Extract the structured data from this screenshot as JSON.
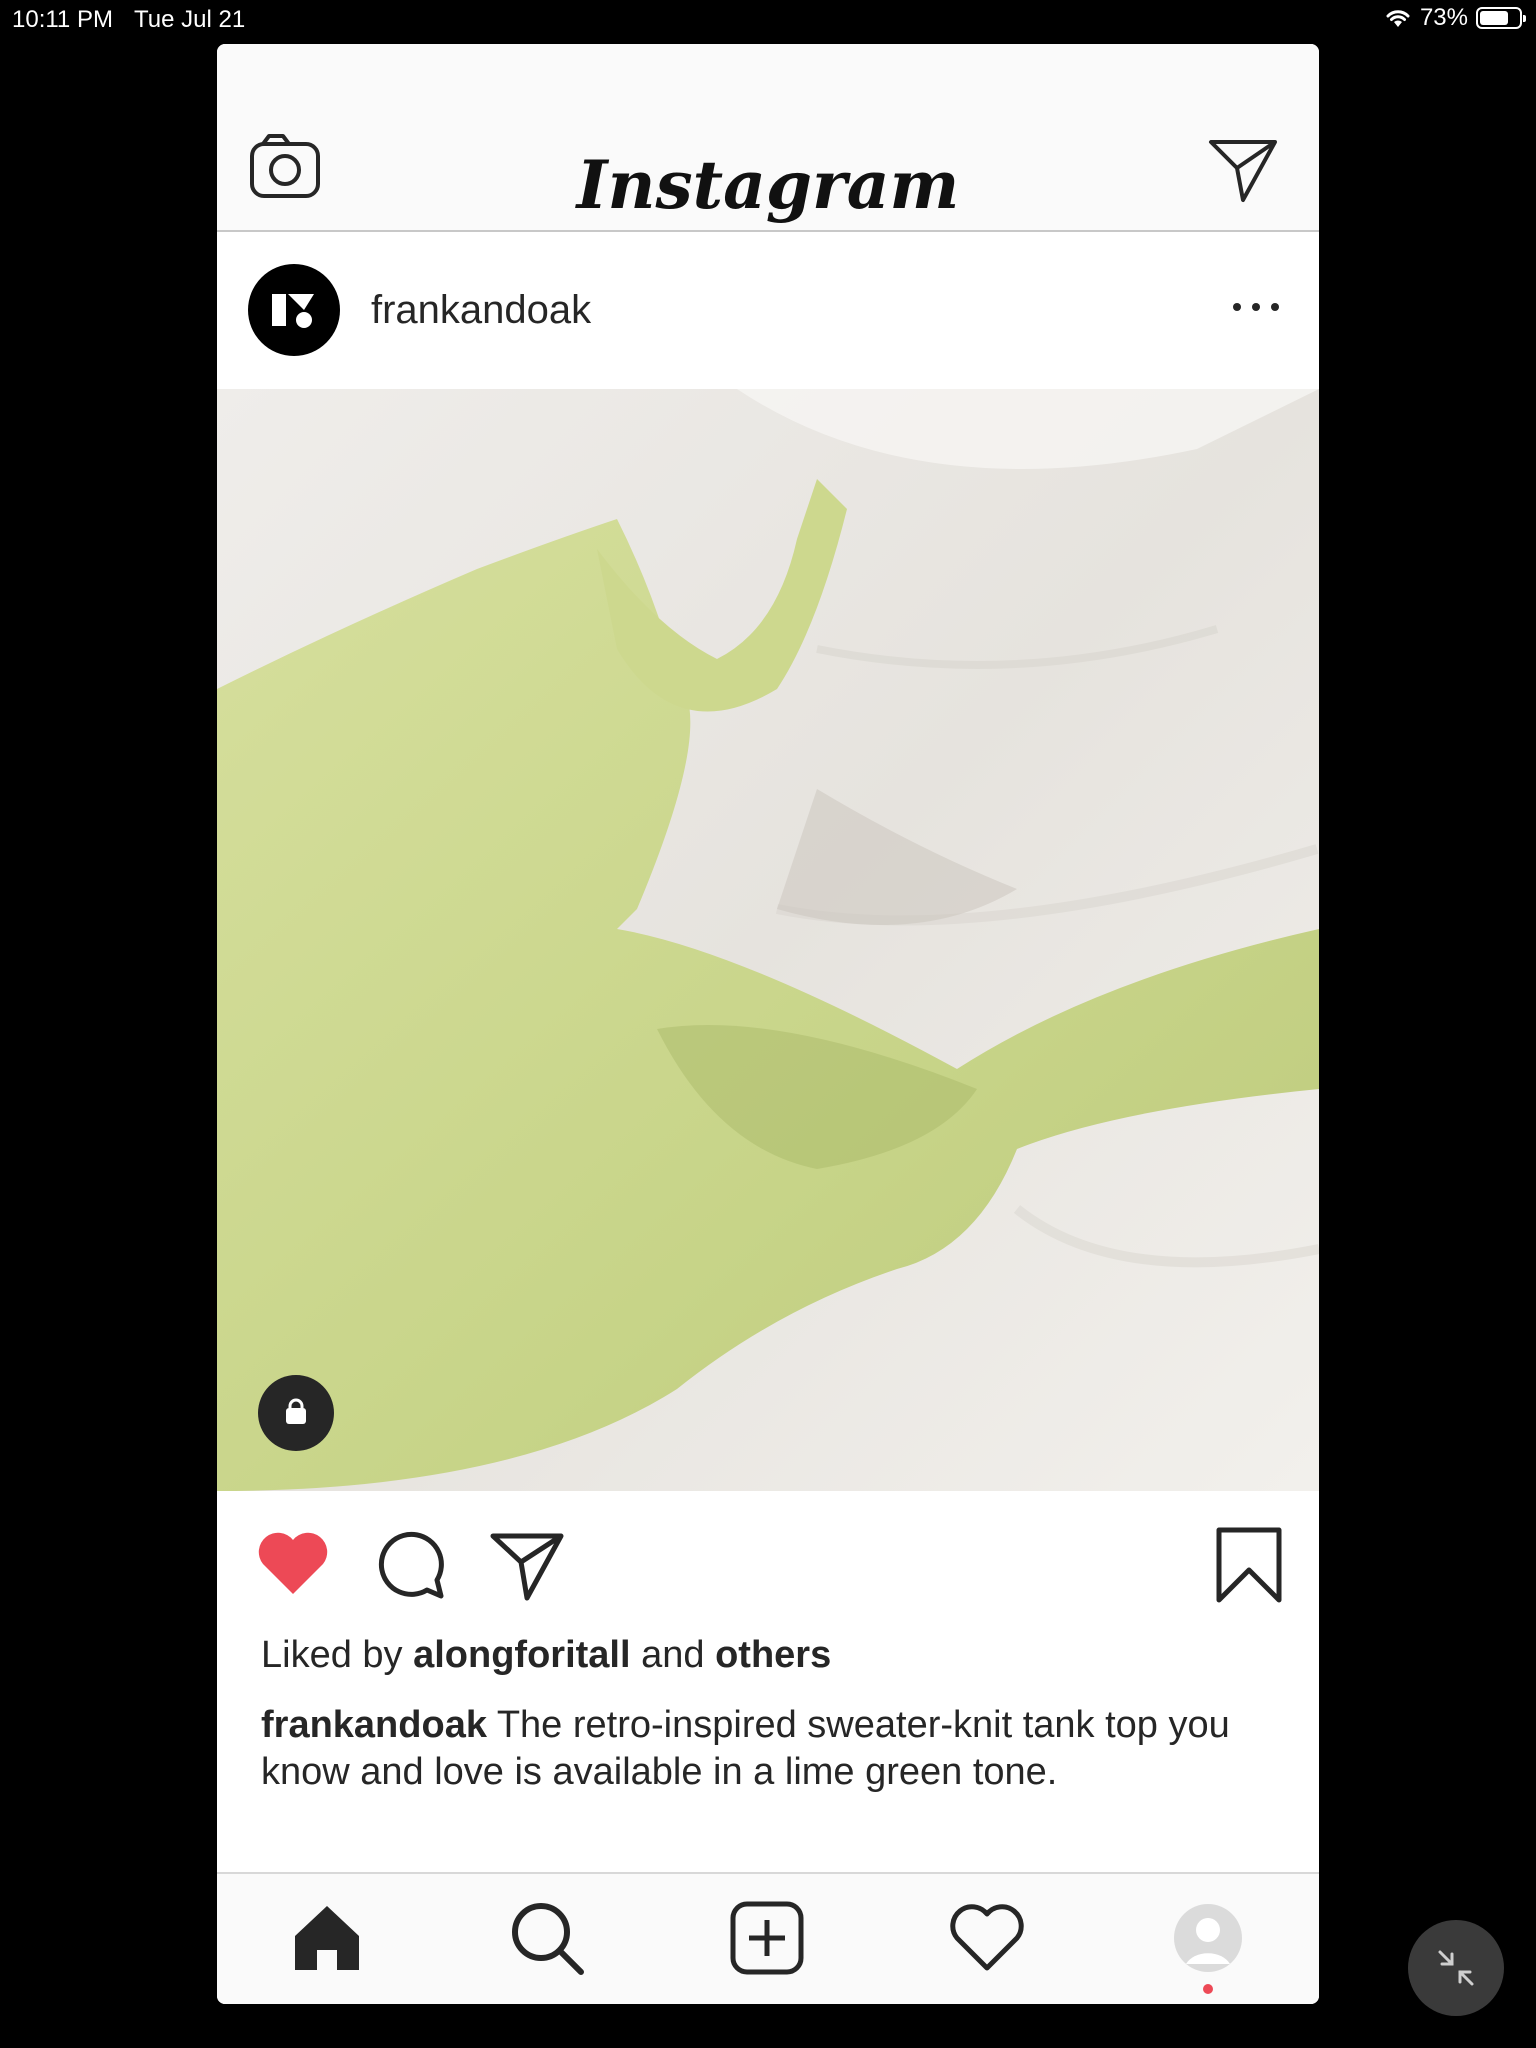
{
  "status_bar": {
    "time": "10:11 PM",
    "date": "Tue Jul 21",
    "battery_percent": "73%",
    "battery_level": 0.73
  },
  "header": {
    "logo_text": "Instagram",
    "camera_icon": "camera-icon",
    "direct_icon": "paper-plane-icon"
  },
  "post": {
    "username": "frankandoak",
    "more_icon": "more-horizontal-icon",
    "shop_icon": "shopping-bag-icon",
    "image_description_colors": {
      "sweater": "#c9d68c",
      "fabric": "#e9e7e3"
    },
    "liked_prefix": "Liked by",
    "liked_user": "alongforitall",
    "liked_connector": "and",
    "liked_others": "others",
    "caption_user": "frankandoak",
    "caption_text": " The retro-inspired sweater-knit tank top you know and love is available in a lime green tone."
  },
  "actions": {
    "like_icon": "heart-filled-icon",
    "comment_icon": "comment-icon",
    "share_icon": "paper-plane-icon",
    "save_icon": "bookmark-icon",
    "liked_color": "#ed4956"
  },
  "tab_bar": {
    "items": [
      "home-icon",
      "search-icon",
      "add-post-icon",
      "activity-heart-icon",
      "profile-avatar-icon"
    ],
    "notification_color": "#ed4956"
  }
}
